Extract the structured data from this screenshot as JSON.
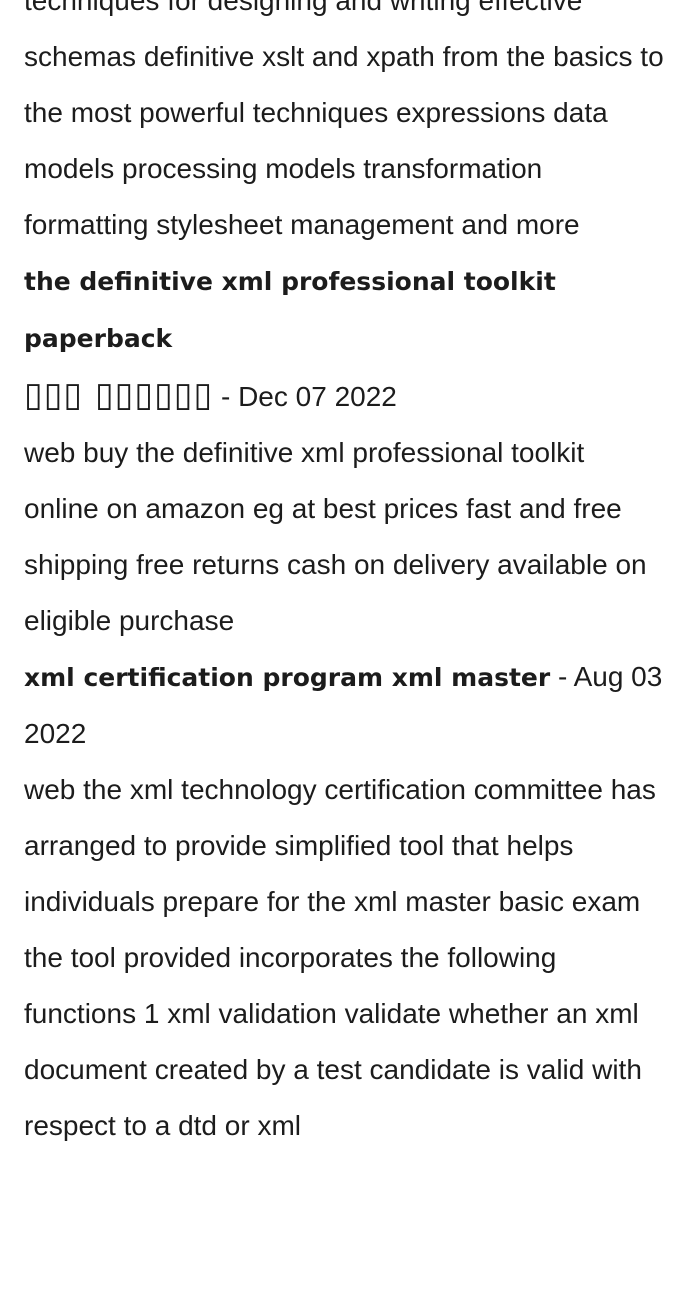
{
  "article": {
    "intro_paragraph": "techniques for designing and writing effective schemas definitive xslt and xpath from the basics to the most powerful techniques expressions data models processing models transformation formatting stylesheet management and more",
    "sections": [
      {
        "title": "the definitive xml professional toolkit paperback",
        "title_glyphs": "▯▯▯ ▯▯▯▯▯▯",
        "date": " - Dec 07 2022",
        "body": "web buy the definitive xml professional toolkit online on amazon eg at best prices fast and free shipping free returns cash on delivery available on eligible purchase"
      },
      {
        "title": "xml certification program xml master",
        "date": " - Aug 03 2022",
        "body": "web the xml technology certification committee has arranged to provide simplified tool that helps individuals prepare for the xml master basic exam the tool provided incorporates the following functions 1 xml validation validate whether an xml document created by a test candidate is valid with respect to a dtd or xml"
      }
    ]
  }
}
